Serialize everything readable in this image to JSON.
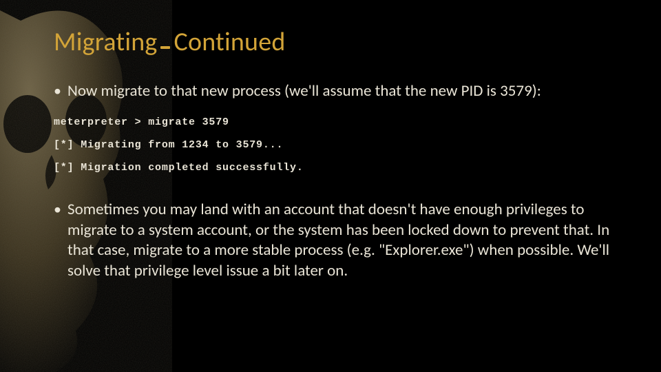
{
  "title": {
    "part1": "Migrating",
    "part2": "Continued"
  },
  "bullet1": "Now migrate to that new process (we'll assume that the new PID is 3579):",
  "code": {
    "line1": "meterpreter > migrate 3579",
    "line2": "[*] Migrating from 1234 to 3579...",
    "line3": "[*] Migration completed successfully."
  },
  "bullet2": "Sometimes you may land with an account that doesn't have enough privileges to migrate to a system account, or the system has been locked down to prevent that.  In that case, migrate to a more stable process (e.g. \"Explorer.exe\") when possible.  We'll solve that privilege level issue a bit later on."
}
